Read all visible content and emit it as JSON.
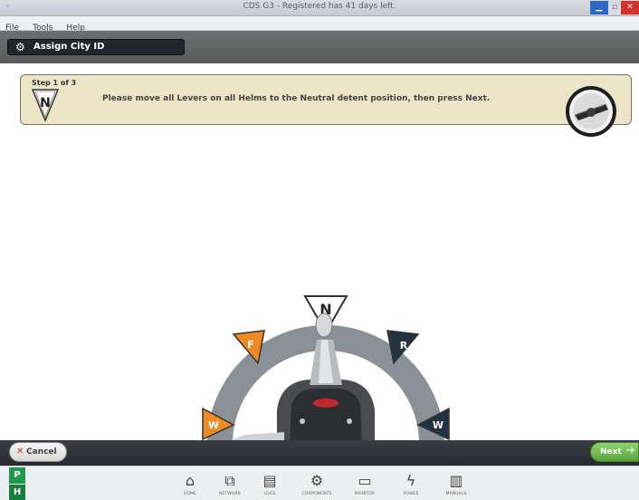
{
  "window": {
    "title": "CDS G3 - Registered has 41 days left.",
    "controls": {
      "minimize_icon": "minimize-icon",
      "maximize_icon": "maximize-icon",
      "close_icon": "close-icon"
    }
  },
  "menu": {
    "items": [
      "File",
      "Tools",
      "Help"
    ]
  },
  "header": {
    "title": "Assign City ID",
    "icon": "gear-icon"
  },
  "step": {
    "label": "Step 1 of 3",
    "badge_letter": "N",
    "instruction": "Please move all Levers on all Helms to the Neutral detent position, then press Next."
  },
  "lever": {
    "positions": [
      {
        "letter": "N",
        "meaning": "neutral"
      },
      {
        "letter": "F",
        "meaning": "forward"
      },
      {
        "letter": "R",
        "meaning": "reverse"
      },
      {
        "letter": "W",
        "meaning": "wide-open-forward"
      },
      {
        "letter": "W",
        "meaning": "wide-open-reverse"
      }
    ],
    "current": "N",
    "colors": {
      "neutral": "#ffffff",
      "forward": "#f08a22",
      "reverse": "#243342",
      "arc": "#8a9095"
    }
  },
  "actions": {
    "cancel": "Cancel",
    "next": "Next"
  },
  "modes": [
    "P",
    "H"
  ],
  "nav": {
    "items": [
      {
        "label": "HOME",
        "icon": "home-icon",
        "glyph": "⌂"
      },
      {
        "label": "NETWORK",
        "icon": "network-icon",
        "glyph": "⧉"
      },
      {
        "label": "LOGS",
        "icon": "logs-icon",
        "glyph": "▤"
      },
      {
        "label": "COMPONENTS",
        "icon": "components-icon",
        "glyph": "⚙"
      },
      {
        "label": "MONITOR",
        "icon": "monitor-icon",
        "glyph": "▭"
      },
      {
        "label": "POWER",
        "icon": "power-icon",
        "glyph": "ϟ"
      },
      {
        "label": "MANUALS",
        "icon": "manuals-icon",
        "glyph": "▥"
      }
    ]
  }
}
